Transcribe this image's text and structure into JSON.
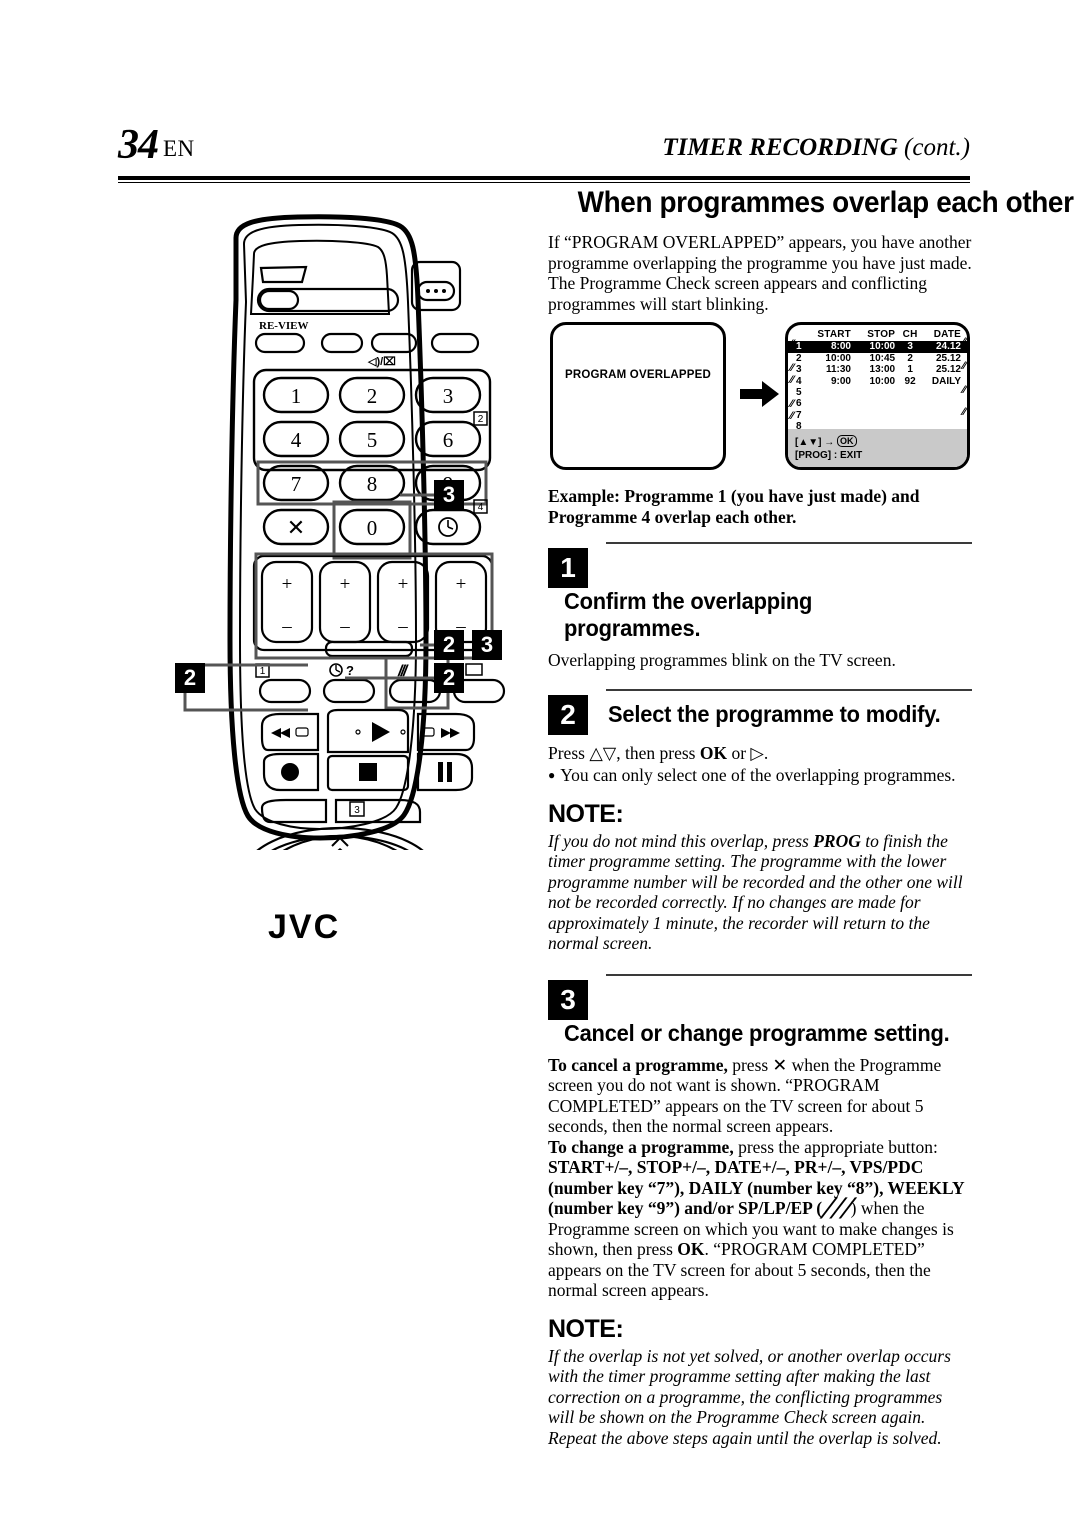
{
  "header": {
    "page_number": "34",
    "language_code": "EN",
    "running_title": "TIMER RECORDING",
    "running_title_cont": "(cont.)"
  },
  "section": {
    "title": "When programmes overlap each other",
    "intro": "If “PROGRAM OVERLAPPED” appears, you have another programme overlapping the programme you have just made. The Programme Check screen appears and conflicting programmes will start blinking."
  },
  "screens": {
    "left_message": "PROGRAM OVERLAPPED",
    "arrow_icon": "right-arrow-icon",
    "table": {
      "columns": [
        "",
        "START",
        "STOP",
        "CH",
        "DATE"
      ],
      "rows": [
        {
          "no": "1",
          "start": "8:00",
          "stop": "10:00",
          "ch": "3",
          "date": "24.12",
          "selected": true
        },
        {
          "no": "2",
          "start": "10:00",
          "stop": "10:45",
          "ch": "2",
          "date": "25.12",
          "selected": false
        },
        {
          "no": "3",
          "start": "11:30",
          "stop": "13:00",
          "ch": "1",
          "date": "25.12",
          "selected": false
        },
        {
          "no": "4",
          "start": "9:00",
          "stop": "10:00",
          "ch": "92",
          "date": "DAILY",
          "selected": false
        },
        {
          "no": "5",
          "start": "",
          "stop": "",
          "ch": "",
          "date": "",
          "selected": false
        },
        {
          "no": "6",
          "start": "",
          "stop": "",
          "ch": "",
          "date": "",
          "selected": false
        },
        {
          "no": "7",
          "start": "",
          "stop": "",
          "ch": "",
          "date": "",
          "selected": false
        },
        {
          "no": "8",
          "start": "",
          "stop": "",
          "ch": "",
          "date": "",
          "selected": false
        }
      ]
    },
    "status_line1_prefix": "[",
    "status_line1_arrows": "▲▼",
    "status_line1_suffix": "] → ",
    "status_ok": "OK",
    "status_line2": "[PROG] : EXIT"
  },
  "example": "Example: Programme 1 (you have just made) and Programme 4 overlap each other.",
  "steps": [
    {
      "number": "1",
      "title": "Confirm the overlapping programmes.",
      "text": "Overlapping programmes blink on the TV screen."
    },
    {
      "number": "2",
      "title": "Select the programme to modify.",
      "text_prefix": "Press ",
      "text_arrows": "△▽",
      "text_mid": ", then press ",
      "text_ok": "OK",
      "text_or": " or ",
      "text_right": "▷",
      "text_suffix": ".",
      "bullet": "You can only select one of the overlapping programmes."
    },
    {
      "number": "3",
      "title": "Cancel or change programme setting."
    }
  ],
  "note1": {
    "heading": "NOTE:",
    "part1": "If you do not mind this overlap, press ",
    "bold1": "PROG",
    "part2": " to finish the timer programme setting. The programme with the lower programme number will be recorded and the other one will not be recorded correctly. If no changes are made for approximately 1 minute, the recorder will return to the normal screen."
  },
  "step3_body": {
    "cancel_bold": "To cancel a programme,",
    "cancel_rest": " press ✕ when the Programme screen you do not want is shown. “PROGRAM COMPLETED” appears on the TV screen for about 5 seconds, then the normal screen appears.",
    "change_bold": "To change a programme,",
    "change_rest1": " press the appropriate button: ",
    "change_buttons": "START+/–, STOP+/–, DATE+/–, PR+/–, VPS/PDC (number key “7”), DAILY (number key “8”), WEEKLY (number key “9”)",
    "change_rest2": " and/or ",
    "change_splpep": "SP/LP/EP",
    "change_paren_open": " (",
    "change_slash_icon": "╱╱╱",
    "change_paren_close": ") ",
    "change_rest3": "when the Programme screen on which you want to make changes is shown, then press ",
    "change_ok": "OK",
    "change_rest4": ". “PROGRAM COMPLETED” appears on the TV screen for about 5 seconds, then the normal screen appears."
  },
  "note2": {
    "heading": "NOTE:",
    "text": "If the overlap is not yet solved, or another overlap occurs with the timer programme setting after making the last correction on a programme, the conflicting programmes will be shown on the Programme Check screen again. Repeat the above steps again until the overlap is solved."
  },
  "remote": {
    "brand": "JVC",
    "review_label": "RE-VIEW",
    "number_keys": [
      "1",
      "2",
      "3",
      "4",
      "5",
      "6",
      "7",
      "8",
      "9"
    ],
    "cancel_key": "✕",
    "zero_key": "0",
    "timer_key": "clock-icon",
    "plus_minus_keys": [
      "+",
      "–",
      "+",
      "–",
      "+",
      "–",
      "+",
      "–"
    ],
    "badge_1": "1",
    "badge_2": "2",
    "badge_3": "3",
    "badge_4": "4",
    "callouts": [
      {
        "label": "3",
        "position": "right-numpad"
      },
      {
        "label": "2",
        "position": "right-prog"
      },
      {
        "label": "3",
        "position": "right-prog-2"
      },
      {
        "label": "2",
        "position": "right-dpad"
      },
      {
        "label": "2",
        "position": "left-dpad"
      }
    ]
  }
}
